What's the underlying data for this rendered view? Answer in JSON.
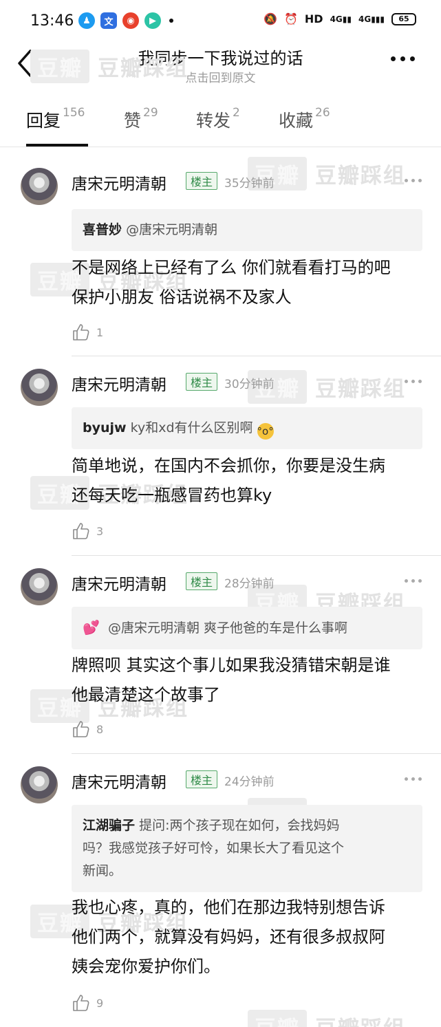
{
  "status_bar": {
    "time": "13:46",
    "right_text": "HD",
    "network_1": "4G",
    "network_2": "4G",
    "battery": "65"
  },
  "nav": {
    "title": "我同步一下我说过的话",
    "subtitle": "点击回到原文"
  },
  "tabs": [
    {
      "label": "回复",
      "count": "156"
    },
    {
      "label": "赞",
      "count": "29"
    },
    {
      "label": "转发",
      "count": "2"
    },
    {
      "label": "收藏",
      "count": "26"
    }
  ],
  "watermark": {
    "box": "豆瓣",
    "text": "豆瓣踩组"
  },
  "comments": [
    {
      "author": "唐宋元明清朝",
      "badge": "楼主",
      "time": "35分钟前",
      "quote_author": "喜普妙",
      "quote_text": "@唐宋元明清朝",
      "body_line1": "不是网络上已经有了么 你们就看看打马的吧",
      "body_line2": "保护小朋友 俗话说祸不及家人",
      "likes": "1"
    },
    {
      "author": "唐宋元明清朝",
      "badge": "楼主",
      "time": "30分钟前",
      "quote_author": "byujw",
      "quote_text": "ky和xd有什么区别啊",
      "body_line1": "简单地说，在国内不会抓你，你要是没生病",
      "body_line2": "还每天吃一瓶感冒药也算ky",
      "likes": "3"
    },
    {
      "author": "唐宋元明清朝",
      "badge": "楼主",
      "time": "28分钟前",
      "quote_author": "",
      "quote_text": "@唐宋元明清朝 爽子他爸的车是什么事啊",
      "body_line1": "牌照呗 其实这个事儿如果我没猜错宋朝是谁",
      "body_line2": "他最清楚这个故事了",
      "likes": "8"
    },
    {
      "author": "唐宋元明清朝",
      "badge": "楼主",
      "time": "24分钟前",
      "quote_author": "江湖骗子",
      "quote_line1": "提问:两个孩子现在如何，会找妈妈",
      "quote_line2": "吗？我感觉孩子好可怜，如果长大了看见这个",
      "quote_line3": "新闻。",
      "body_line1": "我也心疼，真的，他们在那边我特别想告诉",
      "body_line2": "他们两个，就算没有妈妈，还有很多叔叔阿",
      "body_line3": "姨会宠你爱护你们。",
      "likes": "9"
    }
  ]
}
